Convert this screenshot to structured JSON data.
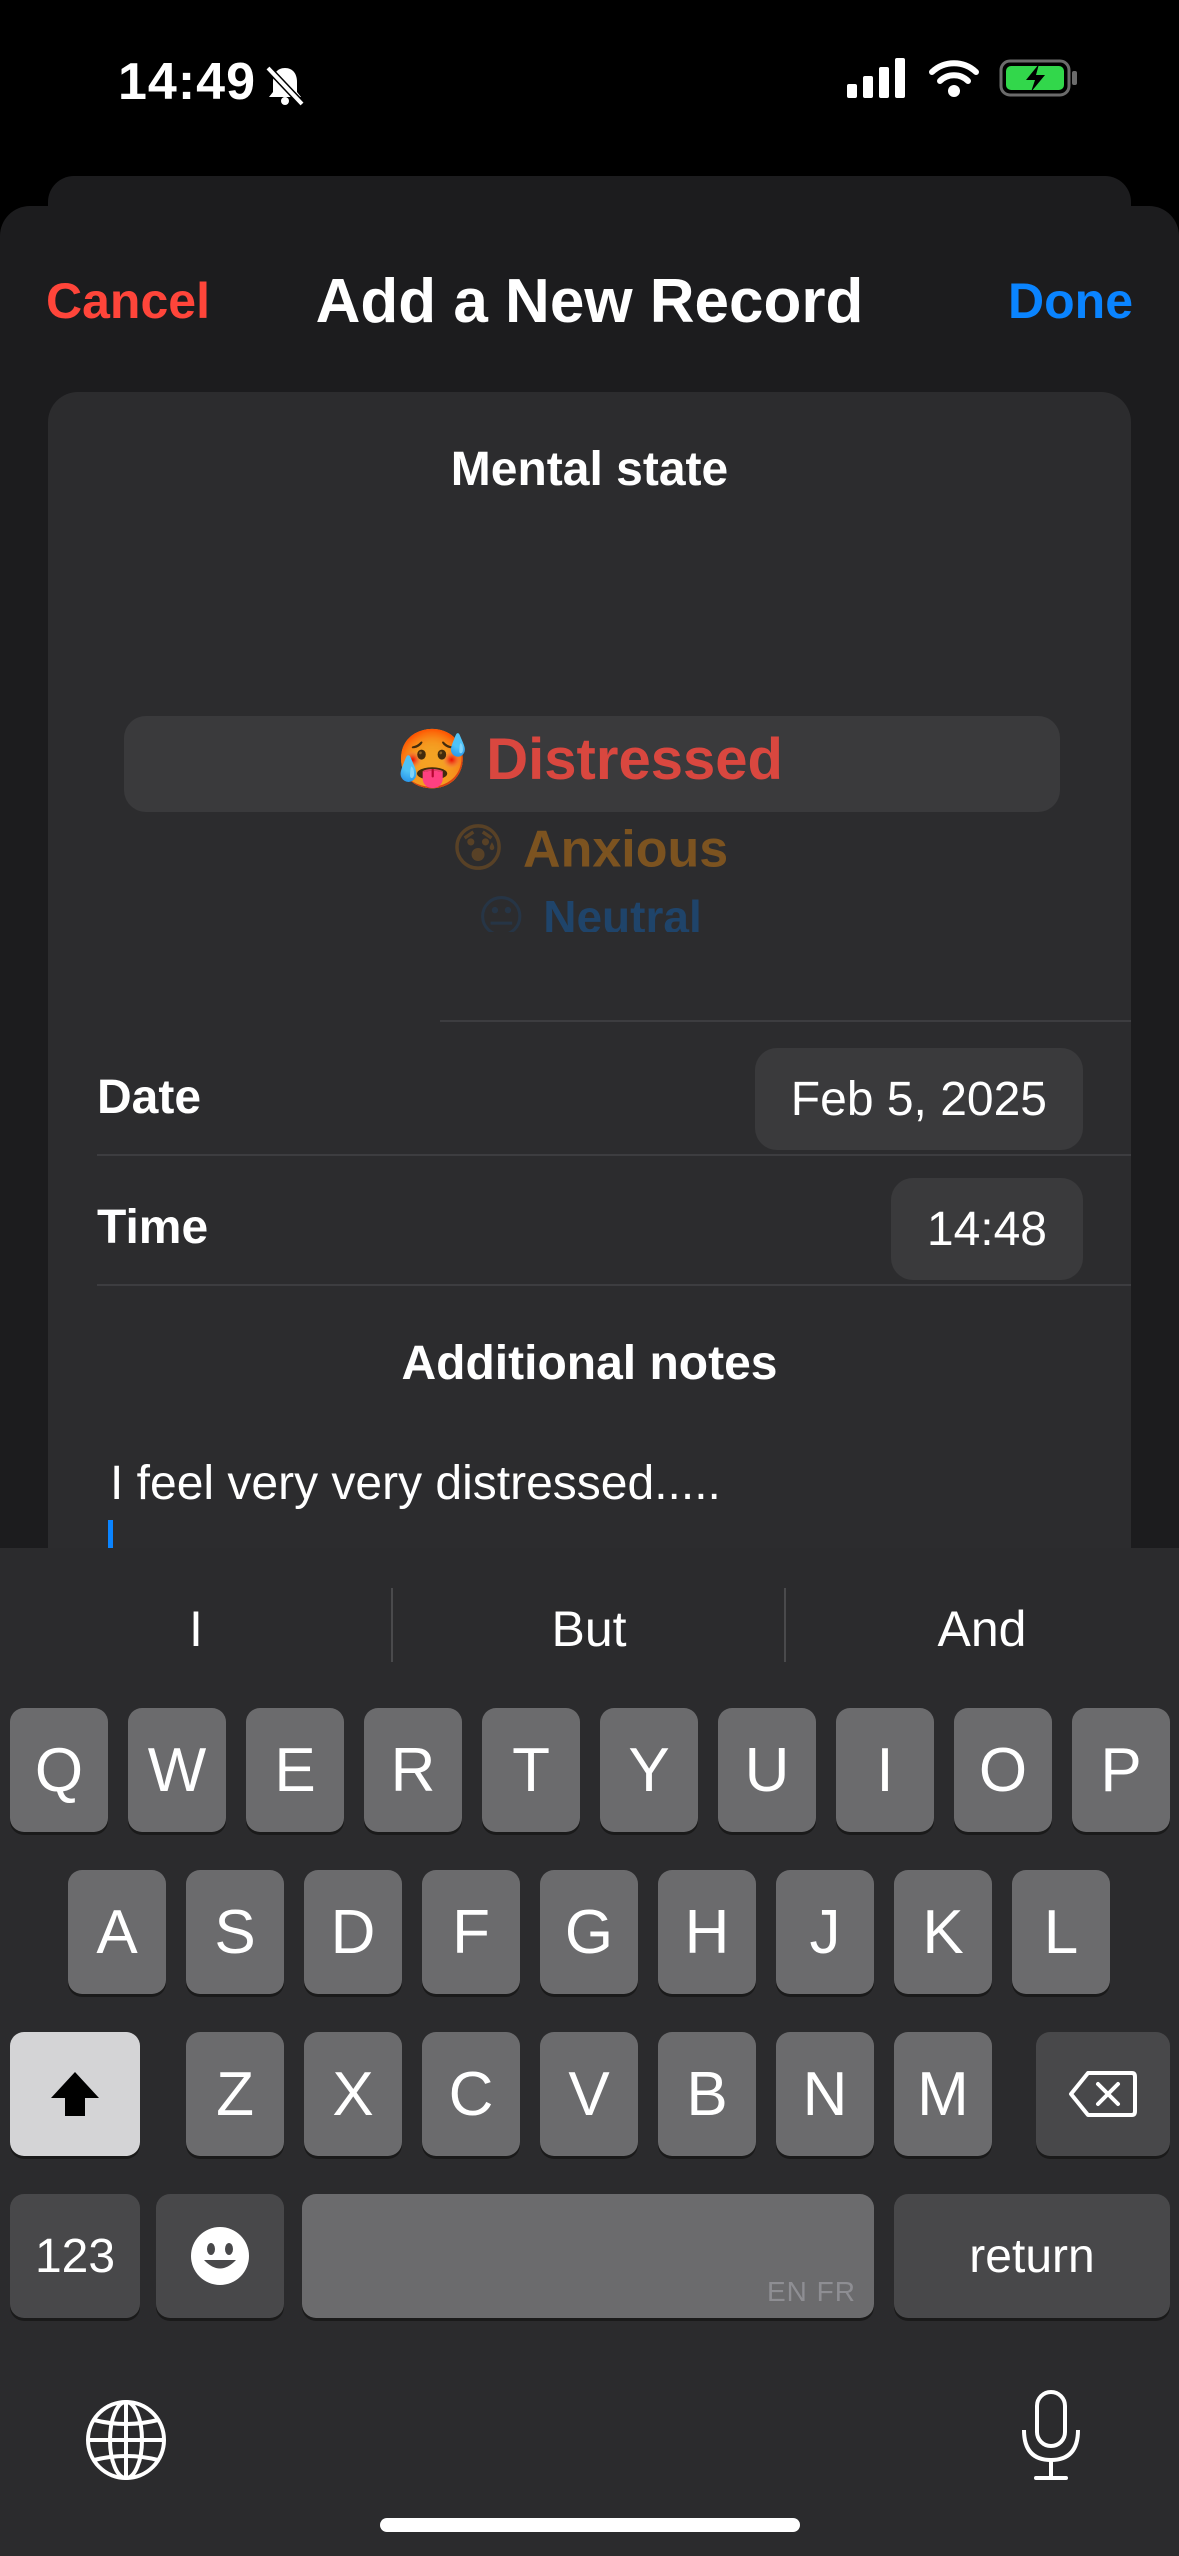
{
  "status_bar": {
    "time": "14:49"
  },
  "nav": {
    "cancel_label": "Cancel",
    "title": "Add a New Record",
    "done_label": "Done"
  },
  "mental_state": {
    "title": "Mental state",
    "options": [
      {
        "emoji": "🥵",
        "label": "Distressed",
        "color": "#d9473f"
      },
      {
        "emoji": "😰",
        "label": "Anxious",
        "color": "#8a5a1e"
      },
      {
        "emoji": "😐",
        "label": "Neutral",
        "color": "#1d4a7a"
      }
    ],
    "selected": "Distressed"
  },
  "date_row": {
    "label": "Date",
    "value": "Feb 5, 2025"
  },
  "time_row": {
    "label": "Time",
    "value": "14:48"
  },
  "notes": {
    "title": "Additional notes",
    "text": "I feel very very distressed....."
  },
  "keyboard": {
    "suggestions": [
      "I",
      "But",
      "And"
    ],
    "row1": [
      "Q",
      "W",
      "E",
      "R",
      "T",
      "Y",
      "U",
      "I",
      "O",
      "P"
    ],
    "row2": [
      "A",
      "S",
      "D",
      "F",
      "G",
      "H",
      "J",
      "K",
      "L"
    ],
    "row3": [
      "Z",
      "X",
      "C",
      "V",
      "B",
      "N",
      "M"
    ],
    "numbers_label": "123",
    "return_label": "return",
    "space_lang": "EN FR"
  },
  "colors": {
    "cancel": "#ff453a",
    "done": "#0a84ff",
    "sheet": "#1c1c1e",
    "card": "#2c2c2e"
  }
}
